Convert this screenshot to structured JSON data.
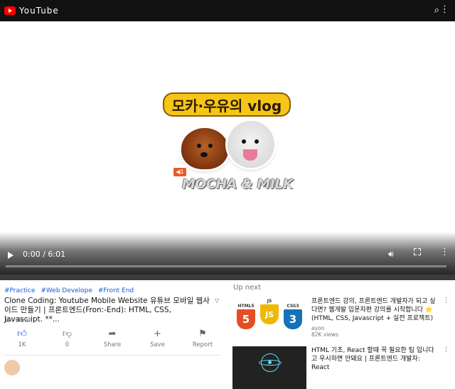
{
  "top_bar": {
    "logo_text": "YouTube"
  },
  "player": {
    "thumb_title": "모카·우유의 vlog",
    "thumb_sticker": "◀1",
    "thumb_subtitle": "MOCHA & MILK",
    "time": "0:00 / 6:01",
    "progress": 0
  },
  "video": {
    "tags": [
      "#Practice",
      "#Web Develope",
      "#Front End"
    ],
    "title": "Clone Coding: Youtube Mobile Website 유튜브 모바일 웹사이드 만들기 | 프론트엔드(Fron:-End): HTML, CSS, Javasc:ipt. **...",
    "views": "1M views",
    "actions": [
      {
        "label": "1K",
        "icon": "thumbs-up-icon"
      },
      {
        "label": "0",
        "icon": "thumbs-down-icon"
      },
      {
        "label": "Share",
        "icon": "share-icon"
      },
      {
        "label": "Save",
        "icon": "plus-icon"
      },
      {
        "label": "Report",
        "icon": "flag-icon"
      }
    ]
  },
  "up_next": {
    "heading": "Up next",
    "items": [
      {
        "title": "프론트엔드 강의, 프론트엔드 개발자가 되고 싶다면? 웹개발 입문자편 강의를 시작합니다 ⭐ (HTML, CSS, Javascript + 실전 프로젝트)",
        "channel": "ayoo",
        "views": "82K views",
        "badges": [
          {
            "label": "HTML5",
            "number": "5",
            "color": "#e44d26"
          },
          {
            "label": "JS",
            "number": "JS",
            "color": "#f0db4f"
          },
          {
            "label": "CSS3",
            "number": "3",
            "color": "#1572b6"
          }
        ]
      },
      {
        "title": "HTML 기초, React 할때 꼭 필요한 팁 입니다고 우시하면 안돼요 | 프론트엔드 개발자: React",
        "channel": "",
        "views": ""
      }
    ]
  },
  "colors": {
    "accent": "#ff0000",
    "link": "#1a5ad7"
  }
}
